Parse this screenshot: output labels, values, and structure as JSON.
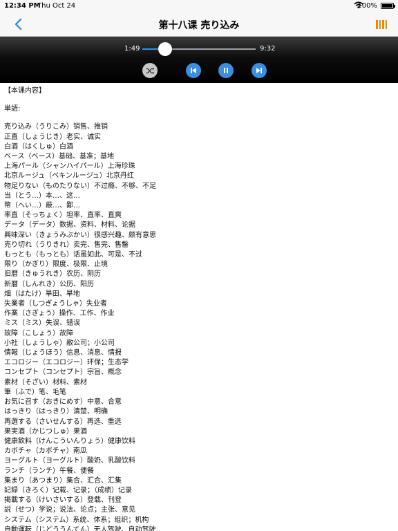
{
  "status": {
    "time": "12:34 PM",
    "date": "Thu Oct 24",
    "battery": "100%"
  },
  "nav": {
    "title": "第十八课 売り込み",
    "back_icon": "chevron-left-icon",
    "menu_icon": "bars-icon",
    "accent": "#f08a00",
    "back_color": "#3a8fe0"
  },
  "player": {
    "current_time": "1:49",
    "duration": "9:32",
    "progress": 0.19
  },
  "content": {
    "section_title": "【本课内容】",
    "words_label": "単語:",
    "vocab": [
      "売り込み（うりこみ）销售、推销",
      "正直（しょうじき）老实、诚实",
      "白酒（はくしゅ）白酒",
      "ベース（ベース）基础、基准；基地",
      "上海パール（シャンハイパール）上海珍珠",
      "北京ルージュ（ペキンルージュ）北京丹红",
      "物足りない（ものたりない）不过瘾、不够、不足",
      "当（とう…）本…、这…",
      "幣（へい…）蔽…、鄙…",
      "率直（そっちょく）坦率、直率、直爽",
      "データ（データ）数据、资料、材料、论据",
      "興味深い（きょうみぶかい）很感兴趣、颇有意思",
      "売り切れ（うりきれ）卖完、售完、售罄",
      "もっとも（もっとも）话虽如此、可是、不过",
      "限り（かぎり）限度、极限、止境",
      "旧暦（きゅうれき）农历、阴历",
      "新暦（しんれき）公历、阳历",
      "畑（はたけ）旱田、旱地",
      "失業者（しつぎょうしゃ）失业者",
      "作業（さぎょう）操作、工作、作业",
      "ミス（ミス）失误、错误",
      "故障（こしょう）故障",
      "小社（しょうしゃ）敝公司；小公司",
      "情報（じょうほう）信息、消息、情报",
      "エコロジー（エコロジー）环保；生态学",
      "コンセプト（コンセプト）宗旨、概念",
      "素材（そざい）材料、素材",
      "筆（ふで）笔、毛笔",
      "お気に召す（おきにめす）中意、合意",
      "はっきり（はっきり）清楚、明确",
      "再選する（さいせんする）再选、重选",
      "果実酒（かじつしゅ）果酒",
      "健康飲料（けんこういんりょう）健康饮料",
      "カボチャ（カボチャ）南瓜",
      "ヨーグルト（ヨーグルト）酸奶、乳酸饮料",
      "ランチ（ランチ）午餐、便餐",
      "集まり（あつまり）集合、汇合、汇集",
      "記録（きろく）记载、记录；（成绩）记录",
      "掲載する（けいさいする）登载、刊登",
      "説（せつ）学说；说法、论点；主张、意见",
      "システム（システム）系统、体系；组织；机构",
      "自動運転（じどううんてん）无人驾驶、自动驾驶"
    ]
  }
}
